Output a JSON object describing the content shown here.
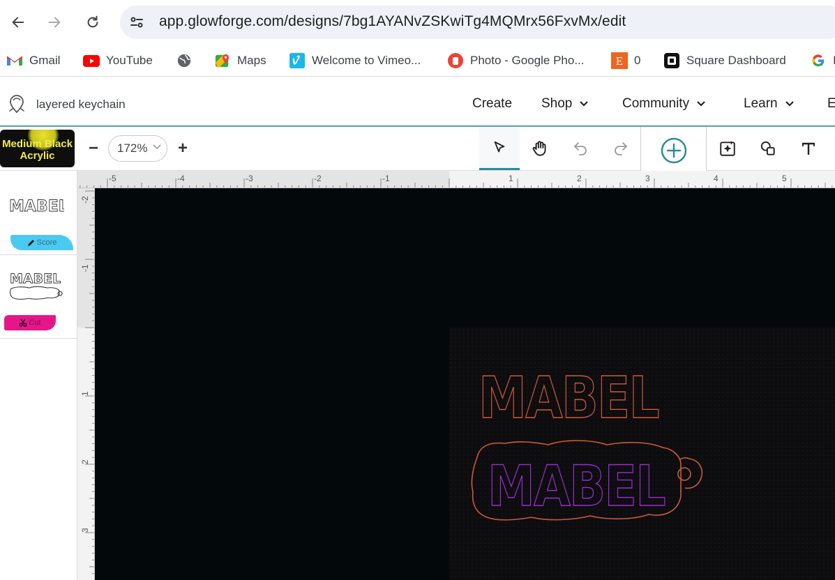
{
  "browser": {
    "url": "app.glowforge.com/designs/7bg1AYANvZSKwiTg4MQMrx56FxvMx/edit",
    "bookmarks": [
      {
        "label": "Gmail",
        "icon": "gmail-icon"
      },
      {
        "label": "YouTube",
        "icon": "youtube-icon"
      },
      {
        "label": "",
        "icon": "globe-icon"
      },
      {
        "label": "Maps",
        "icon": "maps-icon"
      },
      {
        "label": "Welcome to Vimeo...",
        "icon": "vimeo-icon"
      },
      {
        "label": "Photo - Google Pho...",
        "icon": "google-photos-icon"
      },
      {
        "label": "0",
        "icon": "etsy-icon"
      },
      {
        "label": "Square Dashboard",
        "icon": "square-icon"
      },
      {
        "label": "I",
        "icon": "google-icon"
      }
    ]
  },
  "app": {
    "design_name": "layered keychain",
    "nav": {
      "create": "Create",
      "shop": "Shop",
      "community": "Community",
      "learn": "Learn",
      "more": "E"
    }
  },
  "toolbar": {
    "material": "Medium Black Acrylic",
    "zoom": "172%",
    "zoom_minus": "−",
    "zoom_plus": "+"
  },
  "steps": [
    {
      "thumb_text": "MABEL",
      "tag": "Score",
      "tag_color": "#4cc9f0"
    },
    {
      "thumb_text": "MABEL",
      "tag": "Cut",
      "tag_color": "#e6168a"
    }
  ],
  "rulers": {
    "top": [
      "-5",
      "-4",
      "-3",
      "-2",
      "-1",
      "1",
      "2",
      "3",
      "4",
      "5"
    ],
    "left": [
      "-2",
      "-1",
      "1",
      "2",
      "3"
    ]
  },
  "design": {
    "score_text": "MABEL",
    "cut_text": "MABEL",
    "score_color": "#d0583a",
    "cut_color": "#9b2dd0",
    "outline_color": "#d0583a"
  }
}
